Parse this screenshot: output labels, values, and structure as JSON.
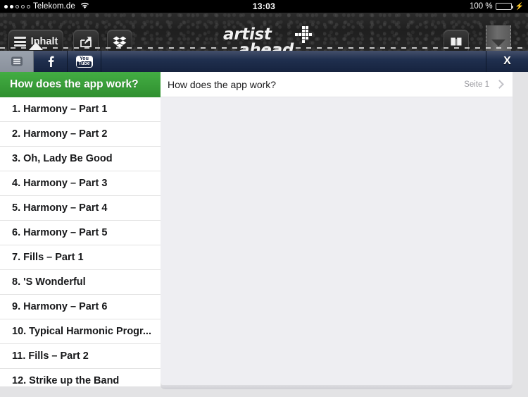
{
  "status_bar": {
    "signal_dots_filled": 2,
    "signal_dots_total": 5,
    "carrier": "Telekom.de",
    "wifi_icon": "wifi-icon",
    "time": "13:03",
    "battery_percent": "100 %",
    "battery_level": 100,
    "charging_icon": "lightning-bolt-icon"
  },
  "app_header": {
    "menu_button": {
      "label": "Inhalt",
      "icon": "hamburger-menu-icon"
    },
    "share_button": {
      "icon": "share-export-icon"
    },
    "dropbox_button": {
      "icon": "dropbox-icon"
    },
    "book_button": {
      "icon": "open-book-icon"
    },
    "logo": {
      "line1": "artist",
      "line2": "ahead",
      "mark": "checkered-plus-icon"
    }
  },
  "toolbar": {
    "items": [
      {
        "name": "list-view",
        "icon": "list-lines-icon",
        "active": true
      },
      {
        "name": "facebook",
        "icon": "facebook-f-icon",
        "label": "f",
        "active": false
      },
      {
        "name": "youtube",
        "icon": "youtube-icon",
        "label_top": "You",
        "label_bottom": "Tube",
        "active": false
      }
    ],
    "close_label": "X"
  },
  "sidebar": {
    "header_title": "How does the app work?",
    "header_color": "#309030",
    "items": [
      {
        "label": "1. Harmony – Part 1"
      },
      {
        "label": "2. Harmony – Part 2"
      },
      {
        "label": "3. Oh, Lady Be Good"
      },
      {
        "label": "4. Harmony – Part 3"
      },
      {
        "label": "5. Harmony – Part 4"
      },
      {
        "label": "6. Harmony – Part 5"
      },
      {
        "label": "7. Fills – Part 1"
      },
      {
        "label": "8. 'S Wonderful"
      },
      {
        "label": "9. Harmony – Part 6"
      },
      {
        "label": "10. Typical Harmonic Progr..."
      },
      {
        "label": "11. Fills – Part 2"
      },
      {
        "label": "12. Strike up the Band"
      }
    ]
  },
  "content": {
    "row_title": "How does the app work?",
    "page_label": "Seite 1",
    "chevron_icon": "chevron-right-icon",
    "background_color": "#eeeef2"
  }
}
